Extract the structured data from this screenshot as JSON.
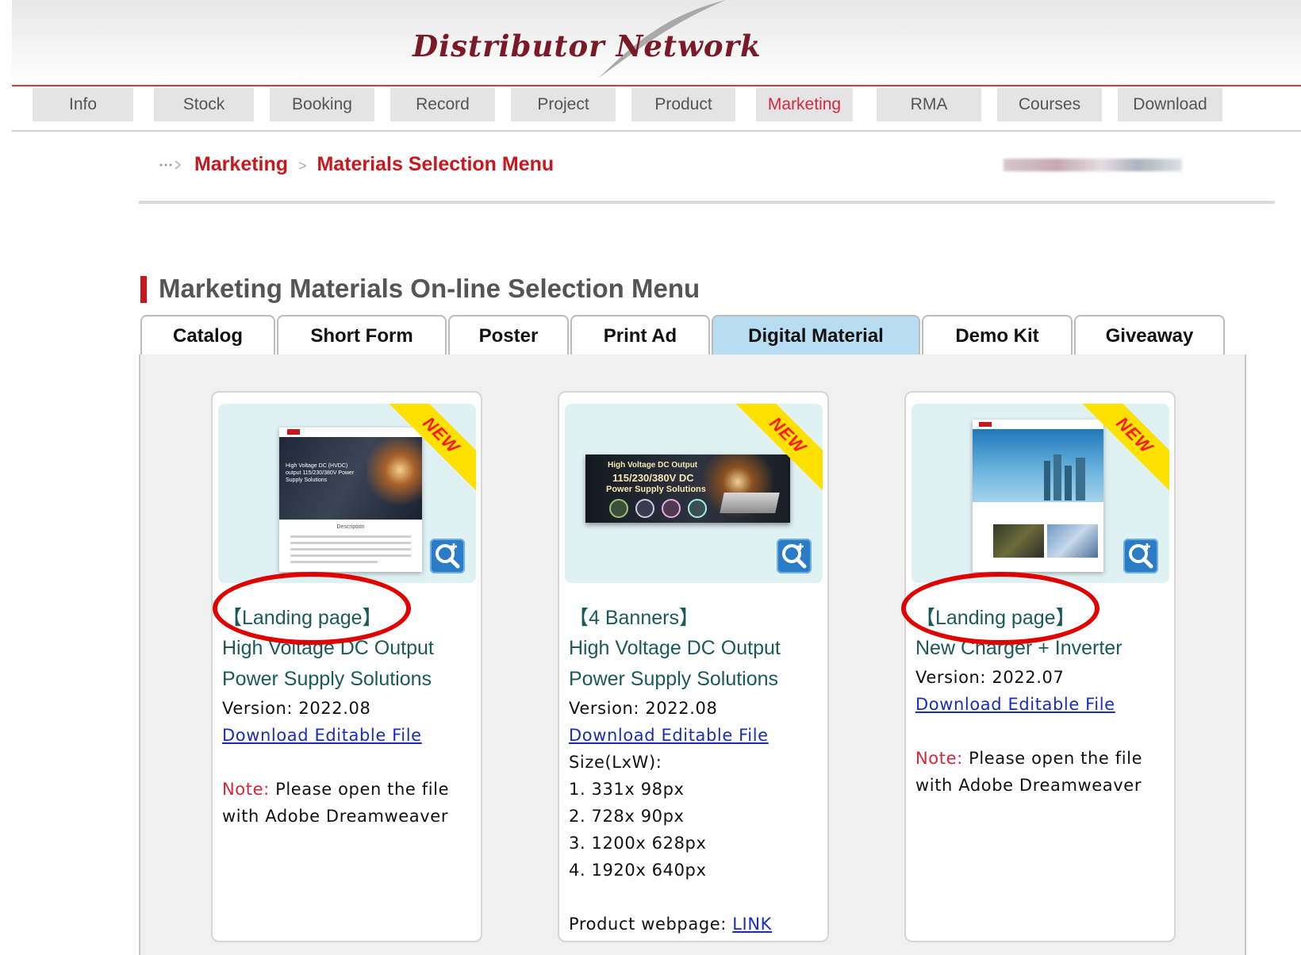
{
  "header": {
    "logo_text": "Distributor Network"
  },
  "nav": {
    "items": [
      "Info",
      "Stock",
      "Booking",
      "Record",
      "Project",
      "Product",
      "Marketing",
      "RMA",
      "Courses",
      "Download"
    ],
    "active": "Marketing"
  },
  "breadcrumb": {
    "level1": "Marketing",
    "level2": "Materials Selection Menu",
    "separator": ">"
  },
  "section": {
    "title": "Marketing Materials On-line Selection Menu"
  },
  "tabs": [
    "Catalog",
    "Short Form",
    "Poster",
    "Print Ad",
    "Digital Material",
    "Demo Kit",
    "Giveaway"
  ],
  "active_tab": "Digital Material",
  "badge": "NEW",
  "cards": [
    {
      "tag": "【Landing page】",
      "title_line1": "High Voltage DC Output",
      "title_line2": "Power Supply Solutions",
      "version": "Version: 2022.08",
      "download_link": "Download Editable File",
      "note_label": "Note:",
      "note_line1": " Please open the file",
      "note_line2": "with Adobe Dreamweaver",
      "thumb_heading": "High Voltage DC (HVDC) output 115/230/380V Power Supply Solutions",
      "thumb_desc": "Description"
    },
    {
      "tag": "【4 Banners】",
      "title_line1": "High Voltage DC Output",
      "title_line2": "Power Supply Solutions",
      "version": "Version: 2022.08",
      "download_link": "Download Editable File",
      "size_label": "Size(LxW):",
      "sizes": [
        "1. 331x 98px",
        "2. 728x 90px",
        "3. 1200x 628px",
        "4. 1920x 640px"
      ],
      "product_label": "Product webpage: ",
      "product_link": "LINK",
      "thumb_line1": "High Voltage DC Output",
      "thumb_line2": "115/230/380V DC",
      "thumb_line3": "Power Supply Solutions"
    },
    {
      "tag": "【Landing page】",
      "title_line1": "New Charger + Inverter",
      "version": "Version: 2022.07",
      "download_link": "Download Editable File",
      "note_label": "Note:",
      "note_line1": " Please open the file",
      "note_line2": "with Adobe Dreamweaver"
    }
  ],
  "colors": {
    "brand_red": "#c8181e",
    "nav_active": "#d1293b",
    "tab_active_bg": "#b8ddf2",
    "link_blue": "#1a2dba",
    "title_teal": "#1b5a5a",
    "badge_yellow": "#ffe100",
    "annotation_red": "#e00000"
  },
  "icons": {
    "zoom": "zoom-in-icon",
    "breadcrumb_arrow": "dotted-arrow-icon"
  }
}
